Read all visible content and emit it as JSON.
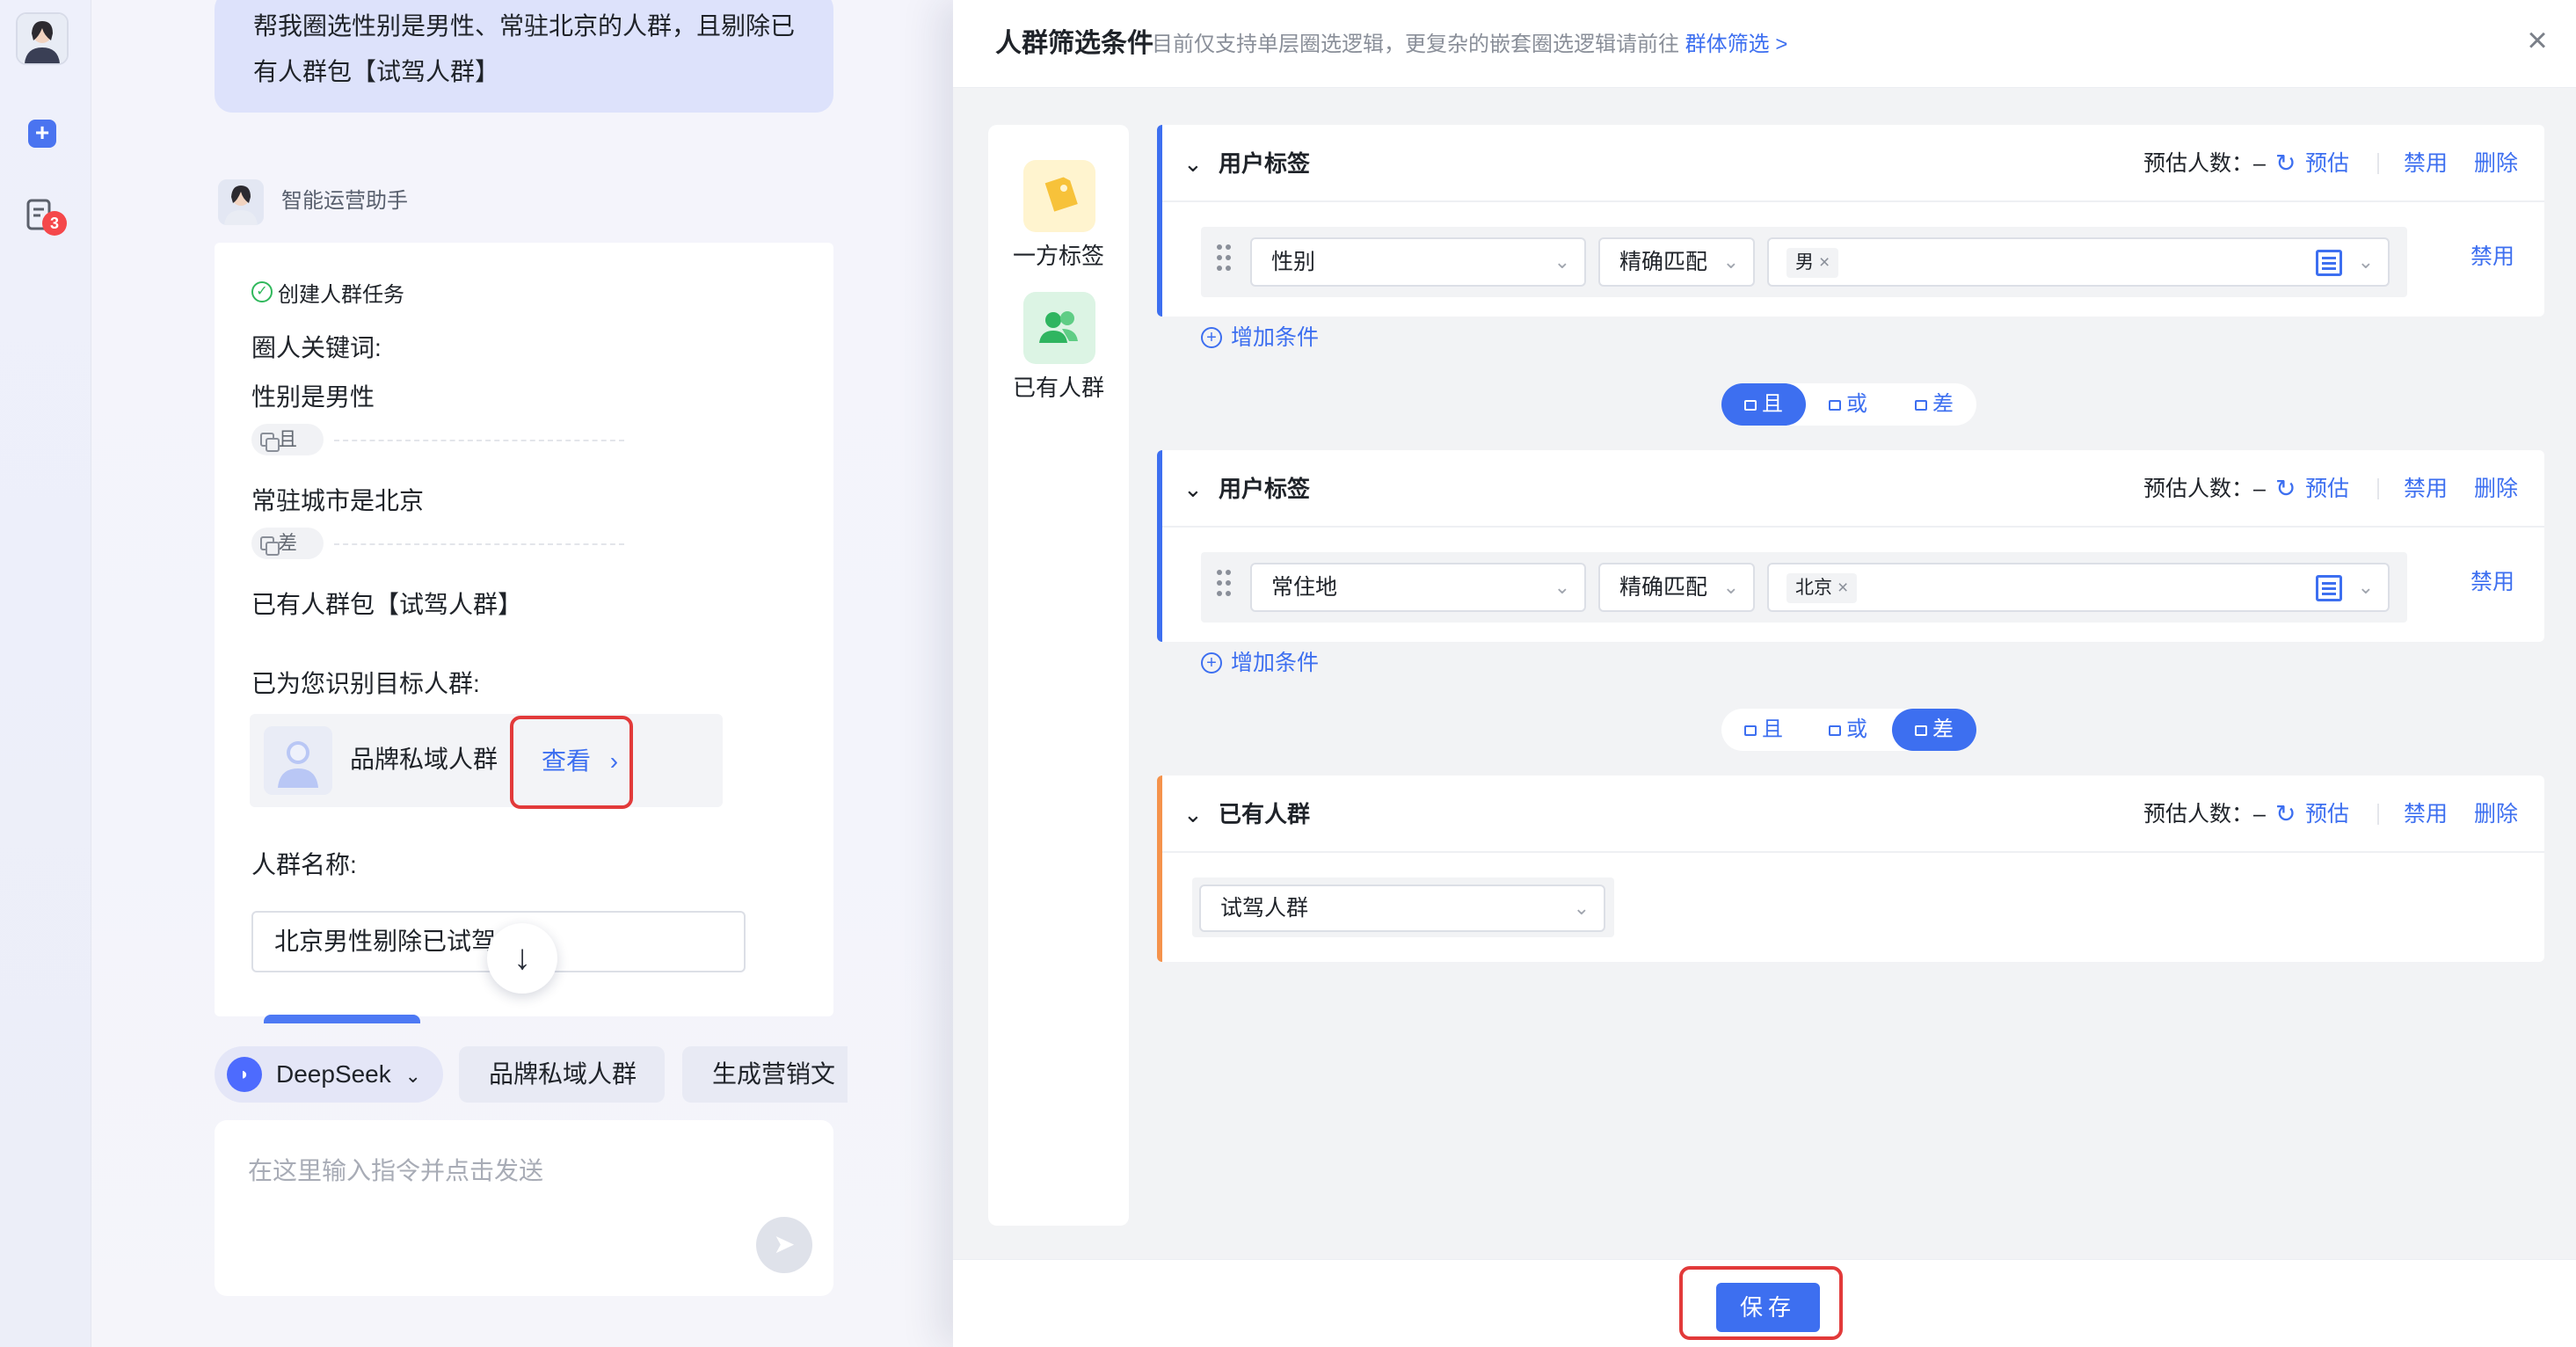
{
  "sidebar": {
    "notification_count": "3"
  },
  "chat": {
    "user_message": "帮我圈选性别是男性、常驻北京的人群，且剔除已有人群包【试驾人群】",
    "bot_name": "智能运营助手",
    "task_title": "创建人群任务",
    "keywords_label": "圈人关键词:",
    "conditions": [
      {
        "text": "性别是男性",
        "op": "且"
      },
      {
        "text": "常驻城市是北京",
        "op": "差"
      },
      {
        "text": "已有人群包【试驾人群】"
      }
    ],
    "identified_label": "已为您识别目标人群:",
    "audience_name": "品牌私域人群",
    "view_label": "查看",
    "crowd_name_label": "人群名称:",
    "crowd_name_value": "北京男性剔除已试驾",
    "chips": [
      "DeepSeek",
      "品牌私域人群",
      "生成营销文"
    ],
    "input_placeholder": "在这里输入指令并点击发送"
  },
  "panel": {
    "title": "人群筛选条件",
    "subtitle": "目前仅支持单层圈选逻辑，更复杂的嵌套圈选逻辑请前往",
    "subtitle_link": "群体筛选 >",
    "left_tabs": [
      {
        "label": "一方标签",
        "icon": "tag-icon",
        "color": "#f7c23a"
      },
      {
        "label": "已有人群",
        "icon": "people-icon",
        "color": "#2fb560"
      }
    ],
    "estimate_label": "预估人数：–",
    "estimate_btn": "预估",
    "disable_btn": "禁用",
    "delete_btn": "删除",
    "add_condition": "增加条件",
    "logic_ops": [
      "且",
      "或",
      "差"
    ],
    "sections": [
      {
        "title": "用户标签",
        "field": "性别",
        "match": "精确匹配",
        "value": "男",
        "active_logic": "且"
      },
      {
        "title": "用户标签",
        "field": "常住地",
        "match": "精确匹配",
        "value": "北京",
        "active_logic": "差"
      },
      {
        "title": "已有人群",
        "crowd": "试驾人群"
      }
    ],
    "save_label": "保存",
    "accent_color": "#3d6ff0",
    "highlight_color": "#e23a3a"
  }
}
